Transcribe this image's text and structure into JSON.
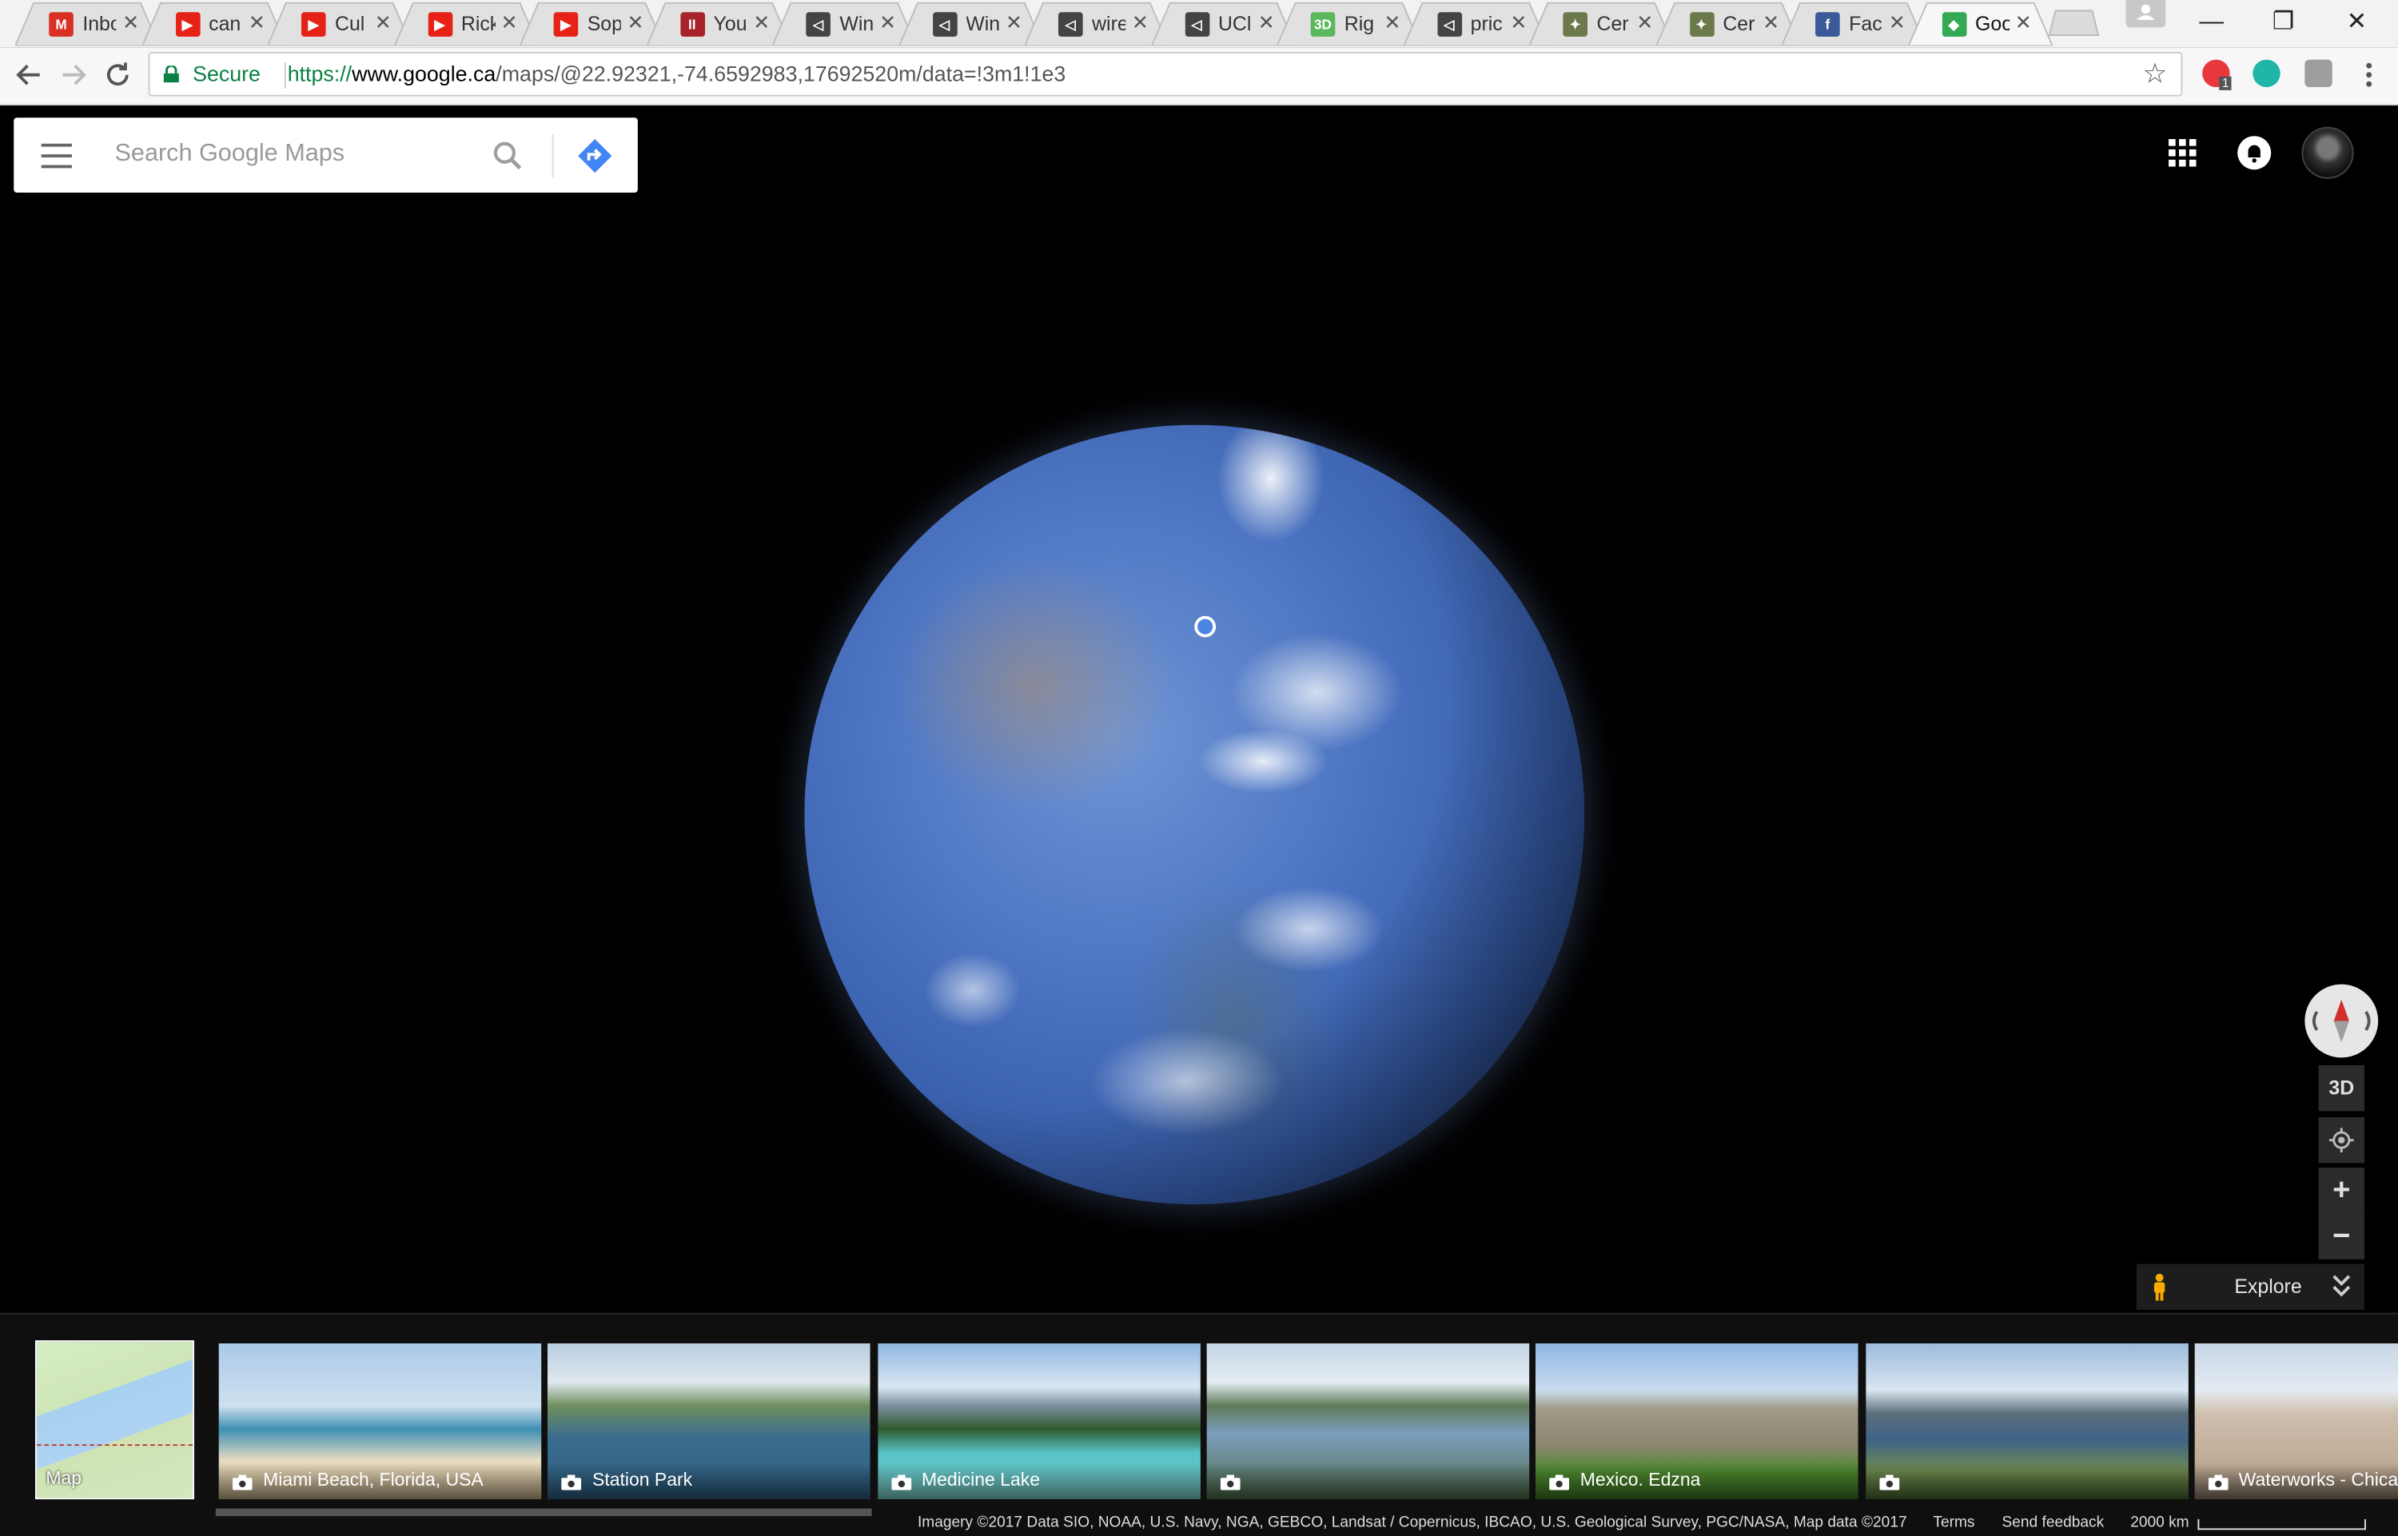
{
  "browser": {
    "tabs": [
      {
        "title": "Inbox",
        "favicon": "gmail-icon",
        "color": "#d93025",
        "letter": "M"
      },
      {
        "title": "can",
        "favicon": "youtube-icon",
        "color": "#e62117",
        "letter": "▶"
      },
      {
        "title": "Cul",
        "favicon": "youtube-icon",
        "color": "#e62117",
        "letter": "▶"
      },
      {
        "title": "Rick",
        "favicon": "youtube-icon",
        "color": "#e62117",
        "letter": "▶"
      },
      {
        "title": "Sop",
        "favicon": "youtube-icon",
        "color": "#e62117",
        "letter": "▶"
      },
      {
        "title": "You",
        "favicon": "pause-icon",
        "color": "#a8222b",
        "letter": "II"
      },
      {
        "title": "Win",
        "favicon": "unity-icon",
        "color": "#444444",
        "letter": "◁"
      },
      {
        "title": "Win",
        "favicon": "unity-icon",
        "color": "#444444",
        "letter": "◁"
      },
      {
        "title": "wire",
        "favicon": "unity-icon",
        "color": "#444444",
        "letter": "◁"
      },
      {
        "title": "UCl",
        "favicon": "unity-icon",
        "color": "#444444",
        "letter": "◁"
      },
      {
        "title": "Rig",
        "favicon": "3d-icon",
        "color": "#5cb85c",
        "letter": "3D"
      },
      {
        "title": "pric",
        "favicon": "unity-icon",
        "color": "#444444",
        "letter": "◁"
      },
      {
        "title": "Cer",
        "favicon": "bird-icon",
        "color": "#6c7a4b",
        "letter": "✦"
      },
      {
        "title": "Cer",
        "favicon": "bird-icon",
        "color": "#6c7a4b",
        "letter": "✦"
      },
      {
        "title": "Fac",
        "favicon": "facebook-icon",
        "color": "#3b5998",
        "letter": "f"
      },
      {
        "title": "Goo",
        "favicon": "google-maps-icon",
        "color": "#34a853",
        "letter": "◆",
        "active": true
      }
    ],
    "window_controls": {
      "minimize": "—",
      "restore": "❐",
      "close": "✕"
    },
    "secure_label": "Secure",
    "url": {
      "scheme": "https://",
      "host": "www.google.ca",
      "path": "/maps/@22.92321,-74.6592983,17692520m/data=!3m1!1e3"
    },
    "extension_badge": "1"
  },
  "maps": {
    "search": {
      "placeholder": "Search Google Maps",
      "value": ""
    },
    "controls": {
      "three_d": "3D",
      "zoom_in": "+",
      "zoom_out": "−"
    },
    "explore": {
      "label": "Explore"
    },
    "map_thumbnail": {
      "label": "Map"
    },
    "cards": [
      {
        "label": "Miami Beach, Florida, USA",
        "scene": "beach"
      },
      {
        "label": "Station Park",
        "scene": "bridge"
      },
      {
        "label": "Medicine Lake",
        "scene": "lake"
      },
      {
        "label": "",
        "scene": "river"
      },
      {
        "label": "Mexico. Edzna",
        "scene": "pyramid"
      },
      {
        "label": "",
        "scene": "coast"
      },
      {
        "label": "Waterworks - Chicago",
        "scene": "building"
      }
    ],
    "footer": {
      "attribution": "Imagery ©2017 Data SIO, NOAA, U.S. Navy, NGA, GEBCO, Landsat / Copernicus, IBCAO, U.S. Geological Survey, PGC/NASA, Map data ©2017",
      "terms": "Terms",
      "feedback": "Send feedback",
      "scale": "2000 km"
    }
  }
}
